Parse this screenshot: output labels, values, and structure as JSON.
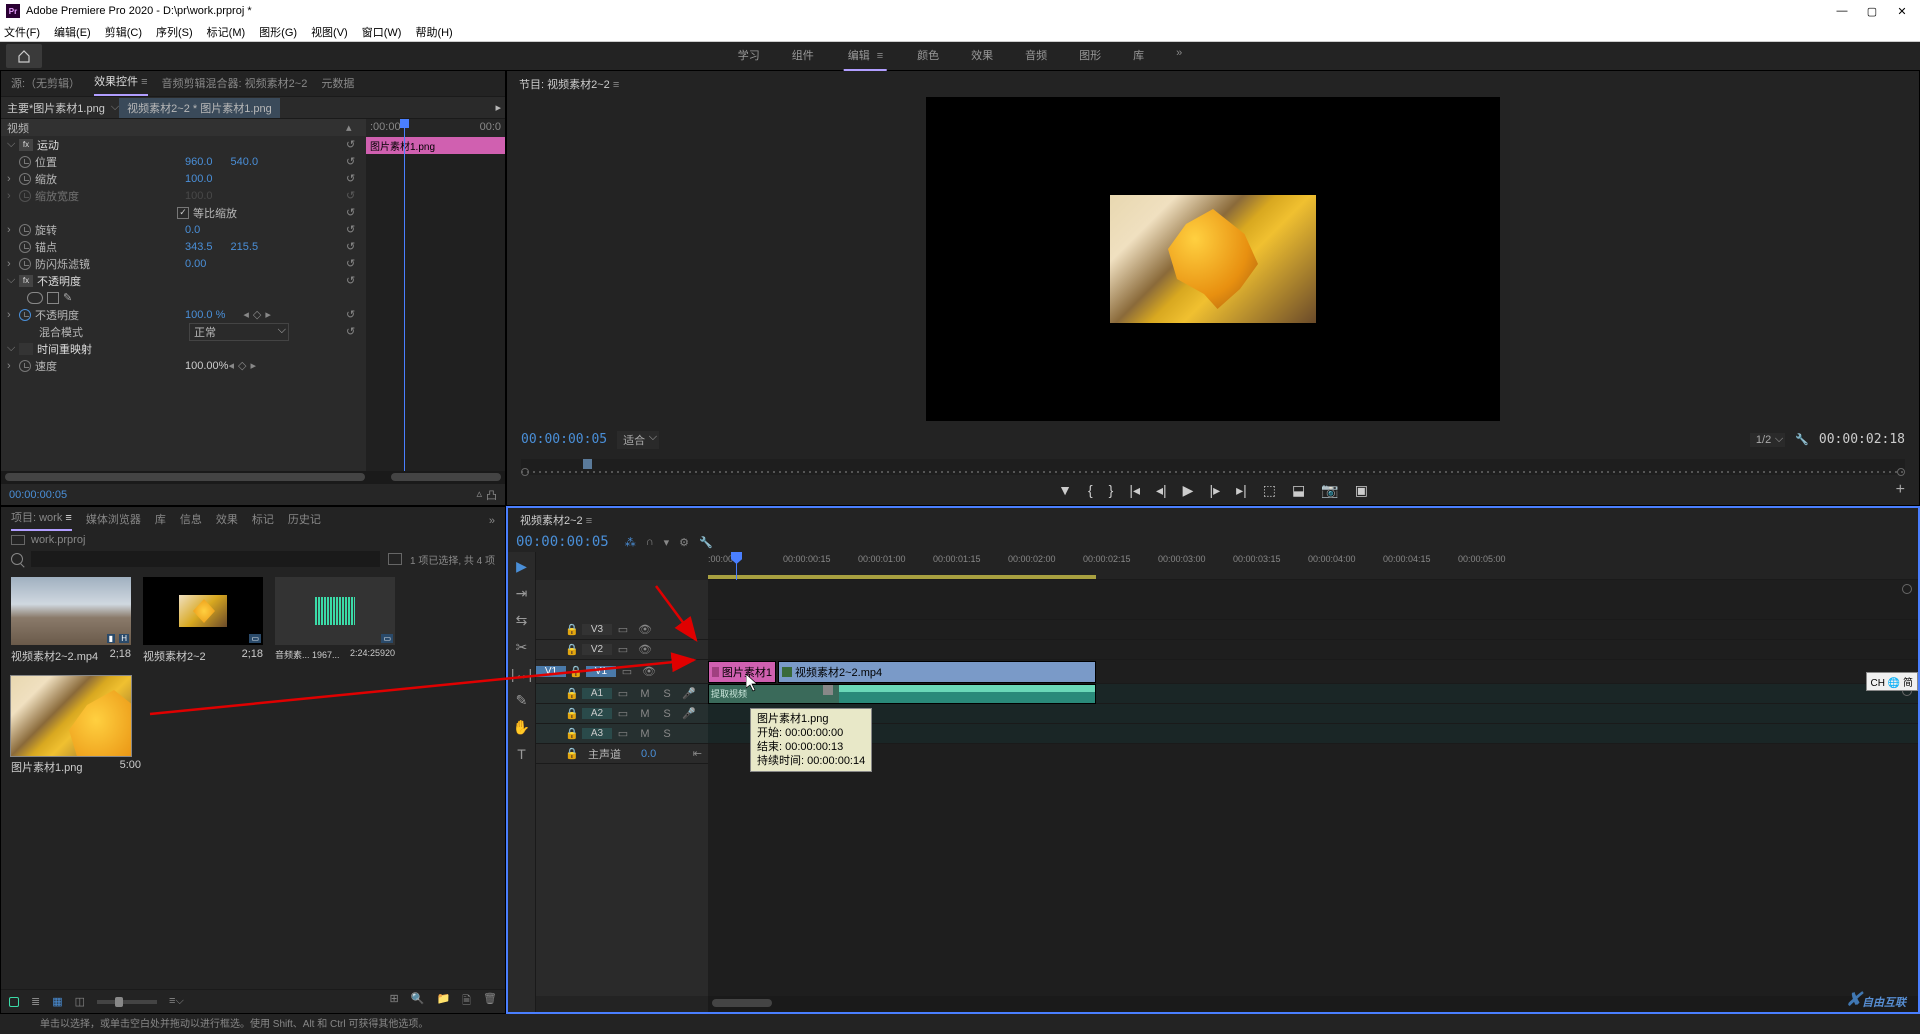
{
  "title": "Adobe Premiere Pro 2020 - D:\\pr\\work.prproj *",
  "menu": [
    "文件(F)",
    "编辑(E)",
    "剪辑(C)",
    "序列(S)",
    "标记(M)",
    "图形(G)",
    "视图(V)",
    "窗口(W)",
    "帮助(H)"
  ],
  "workspaces": [
    "学习",
    "组件",
    "编辑",
    "颜色",
    "效果",
    "音频",
    "图形",
    "库"
  ],
  "ec": {
    "tabs": [
      "源:（无剪辑）",
      "效果控件",
      "音频剪辑混合器: 视频素材2~2",
      "元数据"
    ],
    "src": "主要*图片素材1.png",
    "seq": "视频素材2~2 * 图片素材1.png",
    "ruler": {
      "t0": ":00:00",
      "t1": "00:0"
    },
    "clip": "图片素材1.png",
    "tc": "00:00:00:05",
    "cat_video": "视频",
    "fx_motion": "运动",
    "pos": "位置",
    "pos_x": "960.0",
    "pos_y": "540.0",
    "scale": "缩放",
    "scale_v": "100.0",
    "scalew": "缩放宽度",
    "scalew_v": "100.0",
    "uniform": "等比缩放",
    "rot": "旋转",
    "rot_v": "0.0",
    "anchor": "锚点",
    "anchor_x": "343.5",
    "anchor_y": "215.5",
    "flicker": "防闪烁滤镜",
    "flicker_v": "0.00",
    "fx_opacity": "不透明度",
    "opacity": "不透明度",
    "opacity_v": "100.0 %",
    "blend": "混合模式",
    "blend_v": "正常",
    "fx_time": "时间重映射",
    "speed": "速度",
    "speed_v": "100.00%"
  },
  "program": {
    "title": "节目: 视频素材2~2",
    "tc": "00:00:00:05",
    "fit": "适合",
    "half": "1/2",
    "dur": "00:00:02:18"
  },
  "project": {
    "tabs": [
      "项目: work",
      "媒体浏览器",
      "库",
      "信息",
      "效果",
      "标记",
      "历史记"
    ],
    "bin": "work.prproj",
    "info": "1 项已选择, 共 4 项",
    "items": [
      {
        "name": "视频素材2~2.mp4",
        "dur": "2;18"
      },
      {
        "name": "视频素材2~2",
        "dur": "2;18"
      },
      {
        "name": "音频素...  1967...",
        "dur": "2:24:25920"
      },
      {
        "name": "图片素材1.png",
        "dur": "5:00"
      }
    ]
  },
  "timeline": {
    "title": "视频素材2~2",
    "tc": "00:00:00:05",
    "ticks": [
      ":00:00",
      "00:00:00:15",
      "00:00:01:00",
      "00:00:01:15",
      "00:00:02:00",
      "00:00:02:15",
      "00:00:03:00",
      "00:00:03:15",
      "00:00:04:00",
      "00:00:04:15",
      "00:00:05:00"
    ],
    "tracks_v": [
      "V3",
      "V2",
      "V1"
    ],
    "tracks_a": [
      "A1",
      "A2",
      "A3"
    ],
    "master": "主声道",
    "master_v": "0.0",
    "clip_pink": "图片素材1",
    "clip_blue": "视频素材2~2.mp4",
    "clip_teal": "提取视频",
    "tooltip": {
      "name": "图片素材1.png",
      "start": "开始: 00:00:00:00",
      "end": "结束: 00:00:00:13",
      "dur": "持续时间: 00:00:00:14"
    }
  },
  "status": "单击以选择，或单击空白处并拖动以进行框选。使用 Shift、Alt 和 Ctrl 可获得其他选项。",
  "watermark": "自由互联",
  "ime": "CH 🌐 简"
}
